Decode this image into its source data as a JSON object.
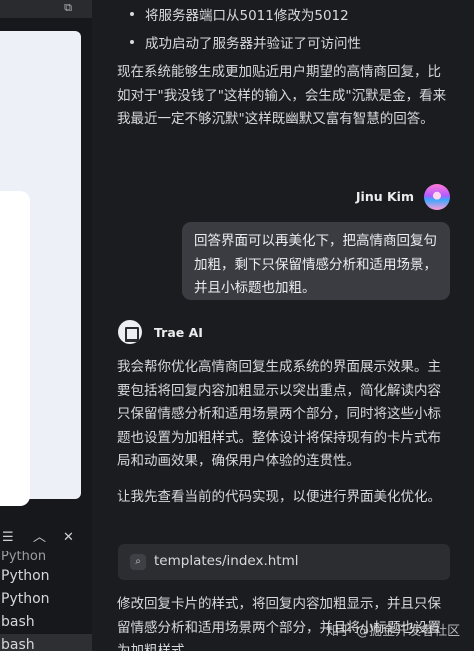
{
  "left_pane": {
    "toolbar": {
      "copy_icon": "copy-icon",
      "settings_icon": "sliders-icon",
      "collapse_icon": "chevron-up-icon",
      "close_icon": "close-icon"
    },
    "terminals": [
      "Python",
      "Python",
      "Python",
      "bash",
      "bash"
    ]
  },
  "chat": {
    "bullets": [
      "将服务器端口从5011修改为5012",
      "成功启动了服务器并验证了可访问性"
    ],
    "summary": "现在系统能够生成更加贴近用户期望的高情商回复，比如对于\"我没钱了\"这样的输入，会生成\"沉默是金，看来我最近一定不够沉默\"这样既幽默又富有智慧的回答。",
    "user_name": "Jinu Kim",
    "user_message": "回答界面可以再美化下，把高情商回复句加粗，剩下只保留情感分析和适用场景，并且小标题也加粗。",
    "ai_name": "Trae AI",
    "ai_reply_1": "我会帮你优化高情商回复生成系统的界面展示效果。主要包括将回复内容加粗显示以突出重点，简化解读内容只保留情感分析和适用场景两个部分，同时将这些小标题也设置为加粗样式。整体设计将保持现有的卡片式布局和动画效果，确保用户体验的连贯性。",
    "ai_reply_2": "让我先查看当前的代码实现，以便进行界面美化优化。",
    "file_chip": "templates/index.html",
    "ai_reply_3": "修改回复卡片的样式，将回复内容加粗显示，并且只保留情感分析和适用场景两个部分，并且将小标题也设置为加粗样式。",
    "watermark": "知乎 @掘金开发者社区"
  }
}
